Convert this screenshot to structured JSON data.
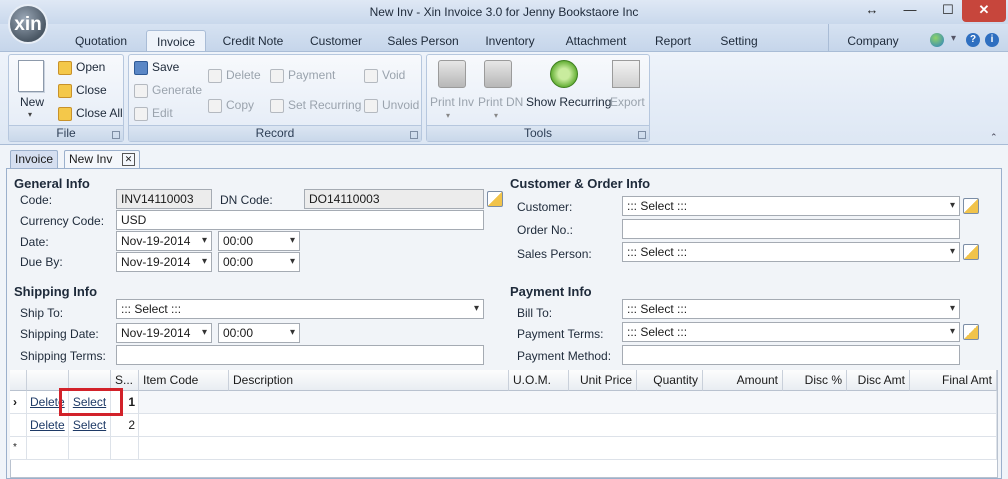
{
  "window": {
    "title": "New Inv - Xin Invoice 3.0 for Jenny Bookstaore Inc",
    "logo_text": "xin",
    "controls": {
      "restore": "↔",
      "minimize": "—",
      "maximize": "☐",
      "close": "✕"
    }
  },
  "menu_tabs": [
    {
      "label": "Quotation"
    },
    {
      "label": "Invoice"
    },
    {
      "label": "Credit Note"
    },
    {
      "label": "Customer"
    },
    {
      "label": "Sales Person"
    },
    {
      "label": "Inventory"
    },
    {
      "label": "Attachment"
    },
    {
      "label": "Report"
    },
    {
      "label": "Setting"
    }
  ],
  "company_tab": "Company",
  "help_icons": {
    "globe": "🌐",
    "arrow": "▾",
    "help": "?",
    "info": "i",
    "collapse": "⌃"
  },
  "ribbon": {
    "file": {
      "label": "File",
      "new": "New",
      "open": "Open",
      "close": "Close",
      "close_all": "Close All"
    },
    "record": {
      "label": "Record",
      "save": "Save",
      "generate": "Generate",
      "edit": "Edit",
      "delete": "Delete",
      "copy": "Copy",
      "payment": "Payment",
      "set_recurring": "Set Recurring",
      "void": "Void",
      "unvoid": "Unvoid"
    },
    "tools": {
      "label": "Tools",
      "print_inv": "Print Inv",
      "print_dn": "Print DN",
      "show_recurring": "Show Recurring",
      "export": "Export"
    }
  },
  "doc_tabs": [
    {
      "label": "Invoice"
    },
    {
      "label": "New Inv"
    }
  ],
  "general": {
    "heading": "General Info",
    "code_label": "Code:",
    "code": "INV14110003",
    "dn_label": "DN Code:",
    "dn": "DO14110003",
    "currency_label": "Currency Code:",
    "currency": "USD",
    "date_label": "Date:",
    "date": "Nov-19-2014",
    "date_time": "00:00",
    "due_label": "Due By:",
    "due": "Nov-19-2014",
    "due_time": "00:00"
  },
  "customer": {
    "heading": "Customer & Order Info",
    "customer_label": "Customer:",
    "customer": "::: Select :::",
    "order_label": "Order No.:",
    "order": "",
    "sales_label": "Sales Person:",
    "sales": "::: Select :::"
  },
  "shipping": {
    "heading": "Shipping Info",
    "ship_to_label": "Ship To:",
    "ship_to": "::: Select :::",
    "date_label": "Shipping Date:",
    "date": "Nov-19-2014",
    "time": "00:00",
    "terms_label": "Shipping Terms:",
    "terms": ""
  },
  "payment": {
    "heading": "Payment Info",
    "bill_to_label": "Bill To:",
    "bill_to": "::: Select :::",
    "terms_label": "Payment Terms:",
    "terms": "::: Select :::",
    "method_label": "Payment Method:",
    "method": ""
  },
  "grid": {
    "columns": [
      "",
      "",
      "S...",
      "Item Code",
      "Description",
      "U.O.M.",
      "Unit Price",
      "Quantity",
      "Amount",
      "Disc %",
      "Disc Amt",
      "Final Amt"
    ],
    "rows": [
      {
        "marker": "›",
        "delete": "Delete",
        "select": "Select",
        "seq": "1"
      },
      {
        "marker": "",
        "delete": "Delete",
        "select": "Select",
        "seq": "2"
      },
      {
        "marker": "*",
        "delete": "",
        "select": "",
        "seq": ""
      }
    ]
  }
}
